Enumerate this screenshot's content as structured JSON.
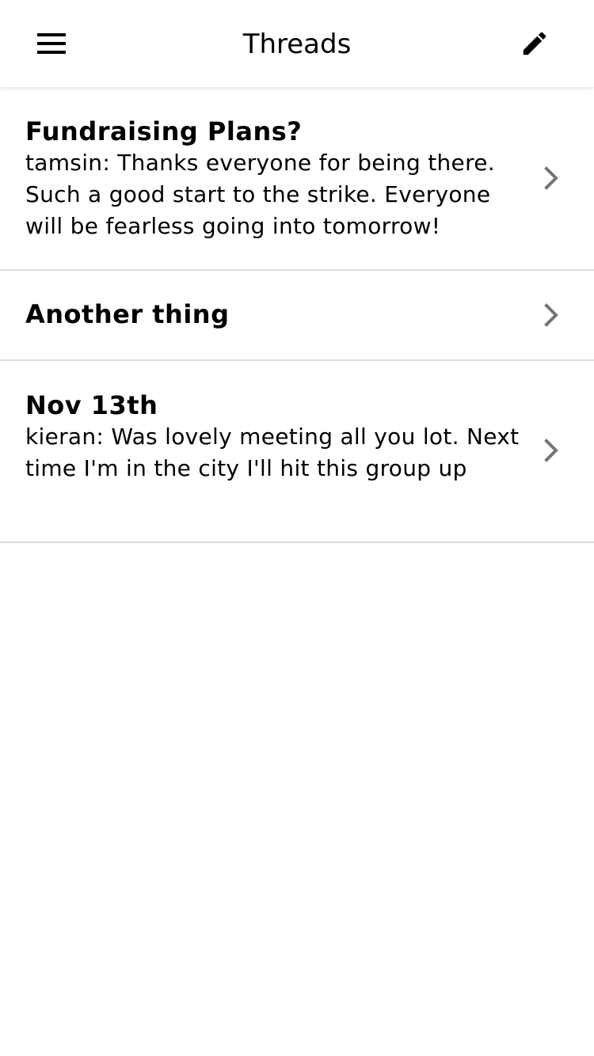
{
  "header": {
    "title": "Threads",
    "menu_icon": "hamburger-menu-icon",
    "edit_icon": "pencil-edit-icon"
  },
  "threads": [
    {
      "title": "Fundraising Plans?",
      "preview": "tamsin: Thanks everyone for being there. Such a good start to the strike. Everyone will be fearless going into tomorrow!"
    },
    {
      "title": "Another thing",
      "preview": ""
    },
    {
      "title": "Nov 13th",
      "preview": "kieran: Was lovely meeting all you lot. Next time I'm in the city I'll hit this group up"
    }
  ],
  "colors": {
    "divider": "#dcdcdc",
    "chevron": "#757575",
    "text": "#000000",
    "background": "#ffffff"
  }
}
